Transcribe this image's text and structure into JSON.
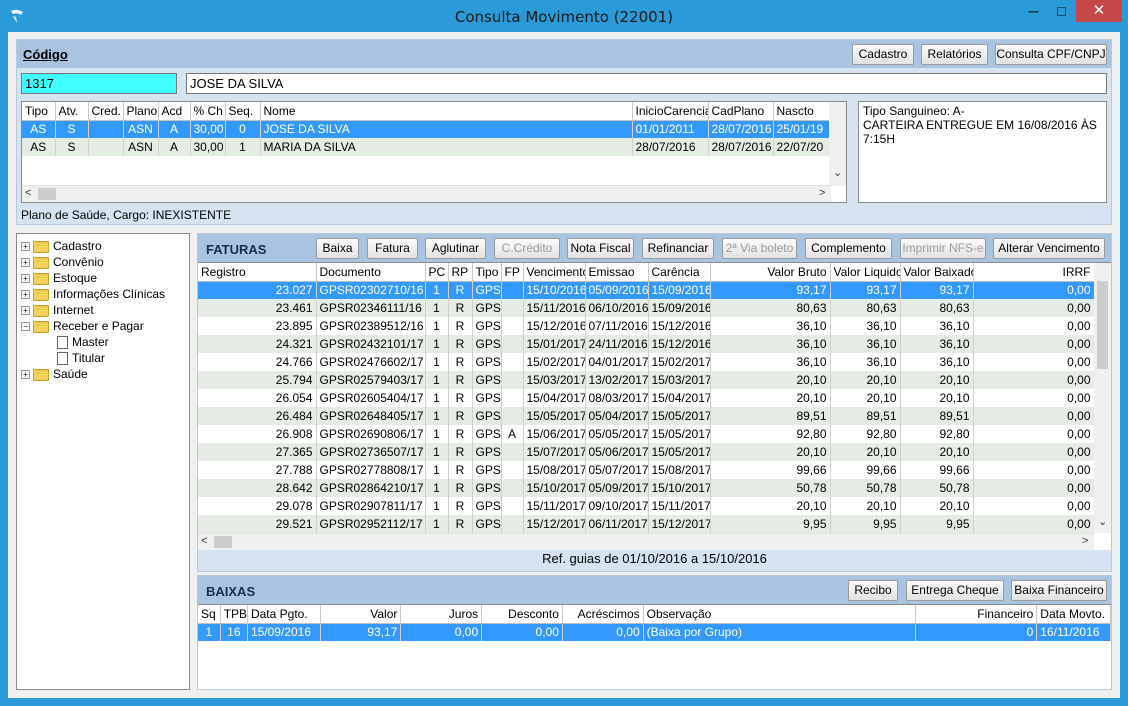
{
  "window": {
    "title": "Consulta Movimento (22001)",
    "min": "─",
    "max": "□",
    "close": "✕"
  },
  "top": {
    "label": "Código",
    "buttons": [
      "Cadastro",
      "Relatórios",
      "Consulta CPF/CNPJ"
    ],
    "code": "1317",
    "name": "JOSE DA SILVA",
    "columns": [
      "Tipo",
      "Atv.",
      "Cred.",
      "Plano",
      "Acd",
      "% Ch",
      "Seq.",
      "Nome",
      "InicioCarencia",
      "CadPlano",
      "Nascto"
    ],
    "rows": [
      [
        "AS",
        "S",
        "",
        "ASN",
        "A",
        "30,00",
        "0",
        "JOSE DA SILVA",
        "01/01/2011",
        "28/07/2016",
        "25/01/19"
      ],
      [
        "AS",
        "S",
        "",
        "ASN",
        "A",
        "30,00",
        "1",
        "MARIA DA SILVA",
        "28/07/2016",
        "28/07/2016",
        "22/07/20"
      ]
    ],
    "info_lines": [
      "Tipo Sanguineo: A-",
      "CARTEIRA ENTREGUE EM 16/08/2016 ÀS 7:15H"
    ],
    "plano": "Plano de Saúde, Cargo: INEXISTENTE"
  },
  "tree": [
    {
      "label": "Cadastro",
      "level": 0,
      "kind": "folder",
      "exp": "+"
    },
    {
      "label": "Convênio",
      "level": 0,
      "kind": "folder",
      "exp": "+"
    },
    {
      "label": "Estoque",
      "level": 0,
      "kind": "folder",
      "exp": "+"
    },
    {
      "label": "Informações Clínicas",
      "level": 0,
      "kind": "folder",
      "exp": "+"
    },
    {
      "label": "Internet",
      "level": 0,
      "kind": "folder",
      "exp": "+"
    },
    {
      "label": "Receber e Pagar",
      "level": 0,
      "kind": "folder",
      "exp": "−"
    },
    {
      "label": "Master",
      "level": 1,
      "kind": "doc"
    },
    {
      "label": "Titular",
      "level": 1,
      "kind": "doc"
    },
    {
      "label": "Saúde",
      "level": 0,
      "kind": "folder",
      "exp": "+"
    }
  ],
  "faturas": {
    "title": "FATURAS",
    "buttons": [
      {
        "label": "Baixa",
        "enabled": true
      },
      {
        "label": "Fatura",
        "enabled": true
      },
      {
        "label": "Aglutinar",
        "enabled": true
      },
      {
        "label": "C.Crédito",
        "enabled": false
      },
      {
        "label": "Nota Fiscal",
        "enabled": true
      },
      {
        "label": "Refinanciar",
        "enabled": true
      },
      {
        "label": "2ª Via boleto",
        "enabled": false
      },
      {
        "label": "Complemento",
        "enabled": true
      },
      {
        "label": "Imprimir NFS-e",
        "enabled": false
      },
      {
        "label": "Alterar Vencimento",
        "enabled": true
      }
    ],
    "columns": [
      "Registro",
      "Documento",
      "PC",
      "RP",
      "Tipo",
      "FP",
      "Vencimento",
      "Emissao",
      "Carência",
      "Valor Bruto",
      "Valor Liquido",
      "Valor Baixado",
      "IRRF"
    ],
    "rows": [
      [
        "23.027",
        "GPSR02302710/16",
        "1",
        "R",
        "GPS",
        "",
        "15/10/2016",
        "05/09/2016",
        "15/09/2016",
        "93,17",
        "93,17",
        "93,17",
        "0,00"
      ],
      [
        "23.461",
        "GPSR02346111/16",
        "1",
        "R",
        "GPS",
        "",
        "15/11/2016",
        "06/10/2016",
        "15/09/2016",
        "80,63",
        "80,63",
        "80,63",
        "0,00"
      ],
      [
        "23.895",
        "GPSR02389512/16",
        "1",
        "R",
        "GPS",
        "",
        "15/12/2016",
        "07/11/2016",
        "15/12/2016",
        "36,10",
        "36,10",
        "36,10",
        "0,00"
      ],
      [
        "24.321",
        "GPSR02432101/17",
        "1",
        "R",
        "GPS",
        "",
        "15/01/2017",
        "24/11/2016",
        "15/12/2016",
        "36,10",
        "36,10",
        "36,10",
        "0,00"
      ],
      [
        "24.766",
        "GPSR02476602/17",
        "1",
        "R",
        "GPS",
        "",
        "15/02/2017",
        "04/01/2017",
        "15/02/2017",
        "36,10",
        "36,10",
        "36,10",
        "0,00"
      ],
      [
        "25.794",
        "GPSR02579403/17",
        "1",
        "R",
        "GPS",
        "",
        "15/03/2017",
        "13/02/2017",
        "15/03/2017",
        "20,10",
        "20,10",
        "20,10",
        "0,00"
      ],
      [
        "26.054",
        "GPSR02605404/17",
        "1",
        "R",
        "GPS",
        "",
        "15/04/2017",
        "08/03/2017",
        "15/04/2017",
        "20,10",
        "20,10",
        "20,10",
        "0,00"
      ],
      [
        "26.484",
        "GPSR02648405/17",
        "1",
        "R",
        "GPS",
        "",
        "15/05/2017",
        "05/04/2017",
        "15/05/2017",
        "89,51",
        "89,51",
        "89,51",
        "0,00"
      ],
      [
        "26.908",
        "GPSR02690806/17",
        "1",
        "R",
        "GPS",
        "A",
        "15/06/2017",
        "05/05/2017",
        "15/05/2017",
        "92,80",
        "92,80",
        "92,80",
        "0,00"
      ],
      [
        "27.365",
        "GPSR02736507/17",
        "1",
        "R",
        "GPS",
        "",
        "15/07/2017",
        "05/06/2017",
        "15/05/2017",
        "20,10",
        "20,10",
        "20,10",
        "0,00"
      ],
      [
        "27.788",
        "GPSR02778808/17",
        "1",
        "R",
        "GPS",
        "",
        "15/08/2017",
        "05/07/2017",
        "15/08/2017",
        "99,66",
        "99,66",
        "99,66",
        "0,00"
      ],
      [
        "28.642",
        "GPSR02864210/17",
        "1",
        "R",
        "GPS",
        "",
        "15/10/2017",
        "05/09/2017",
        "15/10/2017",
        "50,78",
        "50,78",
        "50,78",
        "0,00"
      ],
      [
        "29.078",
        "GPSR02907811/17",
        "1",
        "R",
        "GPS",
        "",
        "15/11/2017",
        "09/10/2017",
        "15/11/2017",
        "20,10",
        "20,10",
        "20,10",
        "0,00"
      ],
      [
        "29.521",
        "GPSR02952112/17",
        "1",
        "R",
        "GPS",
        "",
        "15/12/2017",
        "06/11/2017",
        "15/12/2017",
        "9,95",
        "9,95",
        "9,95",
        "0,00"
      ]
    ],
    "ref": "Ref. guias de 01/10/2016 a 15/10/2016"
  },
  "baixas": {
    "title": "BAIXAS",
    "buttons": [
      "Recibo",
      "Entrega Cheque",
      "Baixa Financeiro"
    ],
    "columns": [
      "Sq",
      "TPBX",
      "Data Pgto.",
      "Valor",
      "Juros",
      "Desconto",
      "Acréscimos",
      "Observação",
      "Financeiro",
      "Data Movto."
    ],
    "rows": [
      [
        "1",
        "16",
        "15/09/2016",
        "93,17",
        "0,00",
        "0,00",
        "0,00",
        "(Baixa por Grupo)",
        "0",
        "16/11/2016"
      ]
    ]
  }
}
